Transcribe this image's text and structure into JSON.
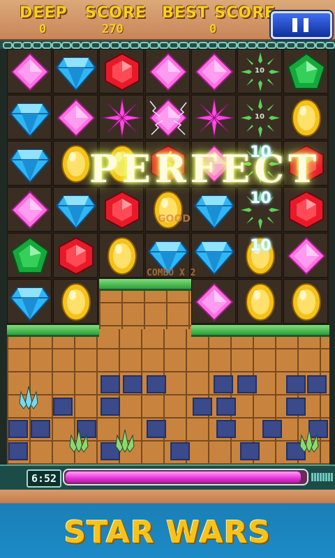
{
  "hud": {
    "deep_label": "DEEP",
    "deep_value": "0",
    "score_label": "SCORE",
    "score_value": "270",
    "best_label": "BEST SCORE",
    "best_value": "0",
    "pause_icon": "pause-icon"
  },
  "board": {
    "rows": [
      [
        "pink-diamond",
        "blue-diamond",
        "red-hexagon",
        "pink-diamond",
        "pink-diamond",
        "green-sparkle",
        "green-pentagon"
      ],
      [
        "blue-diamond",
        "pink-diamond",
        "pink-sparkle",
        "pink-diamond-electric",
        "pink-sparkle",
        "green-sparkle",
        "yellow-oval"
      ],
      [
        "blue-diamond",
        "yellow-oval",
        "yellow-oval",
        "red-hexagon-electric",
        "pink-diamond",
        "green-sparkle",
        "red-hexagon"
      ],
      [
        "pink-diamond",
        "blue-diamond",
        "red-hexagon",
        "yellow-oval",
        "blue-diamond",
        "green-sparkle",
        "red-hexagon"
      ],
      [
        "green-pentagon",
        "red-hexagon",
        "yellow-oval",
        "blue-diamond",
        "blue-diamond",
        "yellow-oval",
        "pink-diamond"
      ],
      [
        "blue-diamond",
        "yellow-oval",
        "empty",
        "empty",
        "pink-diamond",
        "yellow-oval",
        "yellow-oval"
      ]
    ],
    "sparkle_labels": [
      "10",
      "10"
    ]
  },
  "effects": {
    "perfect_text": "PERFECT",
    "popup_values": [
      "10",
      "10",
      "10"
    ],
    "good_text": "GOOD",
    "combo_text": "COMBO X 2"
  },
  "timer": {
    "time_text": "6:52",
    "progress_fraction": 0.98
  },
  "banner": {
    "title": "STAR WARS"
  },
  "colors": {
    "hud_text": "#f2d21e",
    "pause_button": "#2c5ad8",
    "progress_fill": "#e633d6",
    "banner_blue": "#1c8ac7"
  }
}
